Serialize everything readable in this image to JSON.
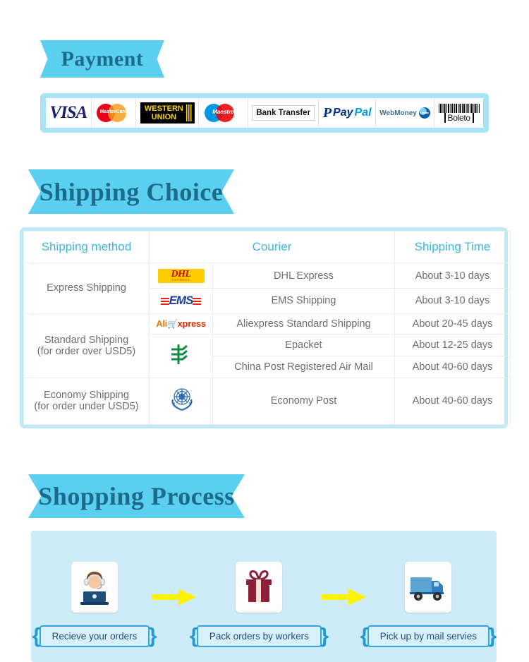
{
  "sections": {
    "payment": {
      "title": "Payment"
    },
    "shipping": {
      "title": "Shipping Choice"
    },
    "process": {
      "title": "Shopping Process"
    }
  },
  "payment_methods": [
    {
      "name": "visa-logo",
      "label": "VISA"
    },
    {
      "name": "mastercard-logo",
      "label": "MasterCard"
    },
    {
      "name": "western-union-logo",
      "label_line1": "WESTERN",
      "label_line2": "UNION"
    },
    {
      "name": "maestro-logo",
      "label": "Maestro"
    },
    {
      "name": "bank-transfer-logo",
      "label": "Bank Transfer"
    },
    {
      "name": "paypal-logo",
      "label_mark": "P",
      "label_a": "Pay",
      "label_b": "Pal"
    },
    {
      "name": "webmoney-logo",
      "label": "WebMoney"
    },
    {
      "name": "boleto-logo",
      "label": "Boleto"
    }
  ],
  "shipping_table": {
    "headers": [
      "Shipping method",
      "Courier",
      "Shipping Time"
    ],
    "rows": [
      {
        "method": "Express Shipping",
        "couriers": [
          {
            "logo": "dhl-logo",
            "logo_text": "DHL",
            "logo_sub": "EXPRESS",
            "name": "DHL Express",
            "time": "About 3-10 days"
          },
          {
            "logo": "ems-logo",
            "logo_text": "EMS",
            "name": "EMS Shipping",
            "time": "About 3-10 days"
          }
        ]
      },
      {
        "method": "Standard Shipping\n(for order over USD5)",
        "method_line1": "Standard Shipping",
        "method_line2": "(for order over USD5)",
        "couriers": [
          {
            "logo": "aliexpress-logo",
            "logo_a": "Ali",
            "logo_b": "xpress",
            "name": "Aliexpress Standard Shipping",
            "time": "About 20-45 days"
          },
          {
            "logo": "china-post-logo",
            "logo_text": "中",
            "name": "Epacket",
            "time": "About 12-25  days"
          },
          {
            "logo": "china-post-logo",
            "name": "China Post Registered Air Mail",
            "time": "About 40-60 days"
          }
        ]
      },
      {
        "method_line1": "Economy Shipping",
        "method_line2": "(for order under USD5)",
        "couriers": [
          {
            "logo": "un-logo",
            "name": "Economy Post",
            "time": "About 40-60 days"
          }
        ]
      }
    ]
  },
  "process_steps": [
    {
      "icon": "support-agent-icon",
      "label": "Recieve your orders"
    },
    {
      "icon": "gift-box-icon",
      "label": "Pack orders by workers"
    },
    {
      "icon": "delivery-truck-icon",
      "label": "Pick up by mail servies"
    }
  ],
  "colors": {
    "ribbon": "#5ACFEF",
    "ribbon_text": "#1B6B8C",
    "table_header_text": "#3BB8E0",
    "table_border": "#BFE9F7",
    "process_bg": "#CDECF8",
    "arrow": "#FFF200",
    "payment_strip_bg": "#A9E2F5"
  }
}
